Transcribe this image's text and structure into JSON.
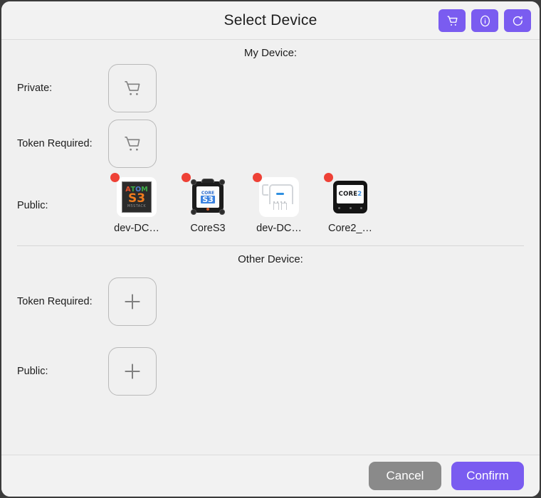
{
  "header": {
    "title": "Select Device",
    "actions": [
      {
        "name": "cart-icon",
        "label": "Cart"
      },
      {
        "name": "info-icon",
        "label": "Info"
      },
      {
        "name": "refresh-icon",
        "label": "Refresh"
      }
    ]
  },
  "my_device": {
    "section_title": "My Device:",
    "rows": [
      {
        "label": "Private:",
        "placeholder_icon": "cart-icon",
        "devices": []
      },
      {
        "label": "Token Required:",
        "placeholder_icon": "cart-icon",
        "devices": []
      },
      {
        "label": "Public:",
        "placeholder_icon": null,
        "devices": [
          {
            "name": "dev-DC…",
            "art": "atom-s3",
            "status_dot": "#ee4136"
          },
          {
            "name": "CoreS3",
            "art": "core-s3",
            "status_dot": "#ee4136"
          },
          {
            "name": "dev-DC…",
            "art": "relay",
            "status_dot": "#ee4136"
          },
          {
            "name": "Core2_…",
            "art": "core2",
            "status_dot": "#ee4136"
          }
        ]
      }
    ]
  },
  "other_device": {
    "section_title": "Other Device:",
    "rows": [
      {
        "label": "Token Required:",
        "placeholder_icon": "plus-icon"
      },
      {
        "label": "Public:",
        "placeholder_icon": "plus-icon"
      }
    ]
  },
  "footer": {
    "cancel_label": "Cancel",
    "confirm_label": "Confirm"
  },
  "device_art": {
    "atom_s3": {
      "word": "ATOM",
      "model": "S3",
      "brand": "M5STACK"
    },
    "core_s3": {
      "top": "CORE",
      "model": "S3"
    },
    "core2": {
      "prefix": "CORE",
      "suffix": "2"
    }
  },
  "colors": {
    "accent": "#7a5cf0",
    "cancel": "#8a8a8a",
    "status_dot": "#ee4136",
    "surface": "#f0f0f0"
  }
}
